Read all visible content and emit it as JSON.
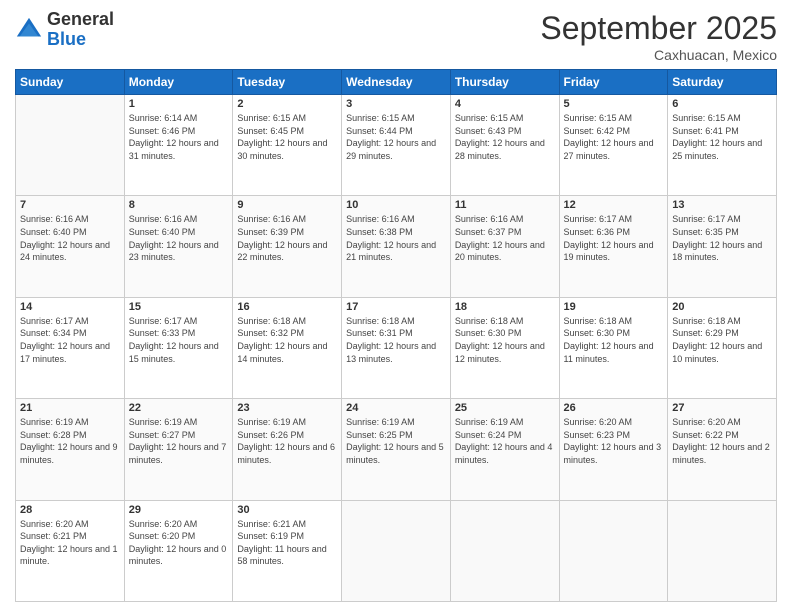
{
  "header": {
    "logo_line1": "General",
    "logo_line2": "Blue",
    "month": "September 2025",
    "location": "Caxhuacan, Mexico"
  },
  "days_of_week": [
    "Sunday",
    "Monday",
    "Tuesday",
    "Wednesday",
    "Thursday",
    "Friday",
    "Saturday"
  ],
  "weeks": [
    [
      {
        "day": "",
        "sunrise": "",
        "sunset": "",
        "daylight": ""
      },
      {
        "day": "1",
        "sunrise": "6:14 AM",
        "sunset": "6:46 PM",
        "daylight": "12 hours and 31 minutes."
      },
      {
        "day": "2",
        "sunrise": "6:15 AM",
        "sunset": "6:45 PM",
        "daylight": "12 hours and 30 minutes."
      },
      {
        "day": "3",
        "sunrise": "6:15 AM",
        "sunset": "6:44 PM",
        "daylight": "12 hours and 29 minutes."
      },
      {
        "day": "4",
        "sunrise": "6:15 AM",
        "sunset": "6:43 PM",
        "daylight": "12 hours and 28 minutes."
      },
      {
        "day": "5",
        "sunrise": "6:15 AM",
        "sunset": "6:42 PM",
        "daylight": "12 hours and 27 minutes."
      },
      {
        "day": "6",
        "sunrise": "6:15 AM",
        "sunset": "6:41 PM",
        "daylight": "12 hours and 25 minutes."
      }
    ],
    [
      {
        "day": "7",
        "sunrise": "6:16 AM",
        "sunset": "6:40 PM",
        "daylight": "12 hours and 24 minutes."
      },
      {
        "day": "8",
        "sunrise": "6:16 AM",
        "sunset": "6:40 PM",
        "daylight": "12 hours and 23 minutes."
      },
      {
        "day": "9",
        "sunrise": "6:16 AM",
        "sunset": "6:39 PM",
        "daylight": "12 hours and 22 minutes."
      },
      {
        "day": "10",
        "sunrise": "6:16 AM",
        "sunset": "6:38 PM",
        "daylight": "12 hours and 21 minutes."
      },
      {
        "day": "11",
        "sunrise": "6:16 AM",
        "sunset": "6:37 PM",
        "daylight": "12 hours and 20 minutes."
      },
      {
        "day": "12",
        "sunrise": "6:17 AM",
        "sunset": "6:36 PM",
        "daylight": "12 hours and 19 minutes."
      },
      {
        "day": "13",
        "sunrise": "6:17 AM",
        "sunset": "6:35 PM",
        "daylight": "12 hours and 18 minutes."
      }
    ],
    [
      {
        "day": "14",
        "sunrise": "6:17 AM",
        "sunset": "6:34 PM",
        "daylight": "12 hours and 17 minutes."
      },
      {
        "day": "15",
        "sunrise": "6:17 AM",
        "sunset": "6:33 PM",
        "daylight": "12 hours and 15 minutes."
      },
      {
        "day": "16",
        "sunrise": "6:18 AM",
        "sunset": "6:32 PM",
        "daylight": "12 hours and 14 minutes."
      },
      {
        "day": "17",
        "sunrise": "6:18 AM",
        "sunset": "6:31 PM",
        "daylight": "12 hours and 13 minutes."
      },
      {
        "day": "18",
        "sunrise": "6:18 AM",
        "sunset": "6:30 PM",
        "daylight": "12 hours and 12 minutes."
      },
      {
        "day": "19",
        "sunrise": "6:18 AM",
        "sunset": "6:30 PM",
        "daylight": "12 hours and 11 minutes."
      },
      {
        "day": "20",
        "sunrise": "6:18 AM",
        "sunset": "6:29 PM",
        "daylight": "12 hours and 10 minutes."
      }
    ],
    [
      {
        "day": "21",
        "sunrise": "6:19 AM",
        "sunset": "6:28 PM",
        "daylight": "12 hours and 9 minutes."
      },
      {
        "day": "22",
        "sunrise": "6:19 AM",
        "sunset": "6:27 PM",
        "daylight": "12 hours and 7 minutes."
      },
      {
        "day": "23",
        "sunrise": "6:19 AM",
        "sunset": "6:26 PM",
        "daylight": "12 hours and 6 minutes."
      },
      {
        "day": "24",
        "sunrise": "6:19 AM",
        "sunset": "6:25 PM",
        "daylight": "12 hours and 5 minutes."
      },
      {
        "day": "25",
        "sunrise": "6:19 AM",
        "sunset": "6:24 PM",
        "daylight": "12 hours and 4 minutes."
      },
      {
        "day": "26",
        "sunrise": "6:20 AM",
        "sunset": "6:23 PM",
        "daylight": "12 hours and 3 minutes."
      },
      {
        "day": "27",
        "sunrise": "6:20 AM",
        "sunset": "6:22 PM",
        "daylight": "12 hours and 2 minutes."
      }
    ],
    [
      {
        "day": "28",
        "sunrise": "6:20 AM",
        "sunset": "6:21 PM",
        "daylight": "12 hours and 1 minute."
      },
      {
        "day": "29",
        "sunrise": "6:20 AM",
        "sunset": "6:20 PM",
        "daylight": "12 hours and 0 minutes."
      },
      {
        "day": "30",
        "sunrise": "6:21 AM",
        "sunset": "6:19 PM",
        "daylight": "11 hours and 58 minutes."
      },
      {
        "day": "",
        "sunrise": "",
        "sunset": "",
        "daylight": ""
      },
      {
        "day": "",
        "sunrise": "",
        "sunset": "",
        "daylight": ""
      },
      {
        "day": "",
        "sunrise": "",
        "sunset": "",
        "daylight": ""
      },
      {
        "day": "",
        "sunrise": "",
        "sunset": "",
        "daylight": ""
      }
    ]
  ]
}
